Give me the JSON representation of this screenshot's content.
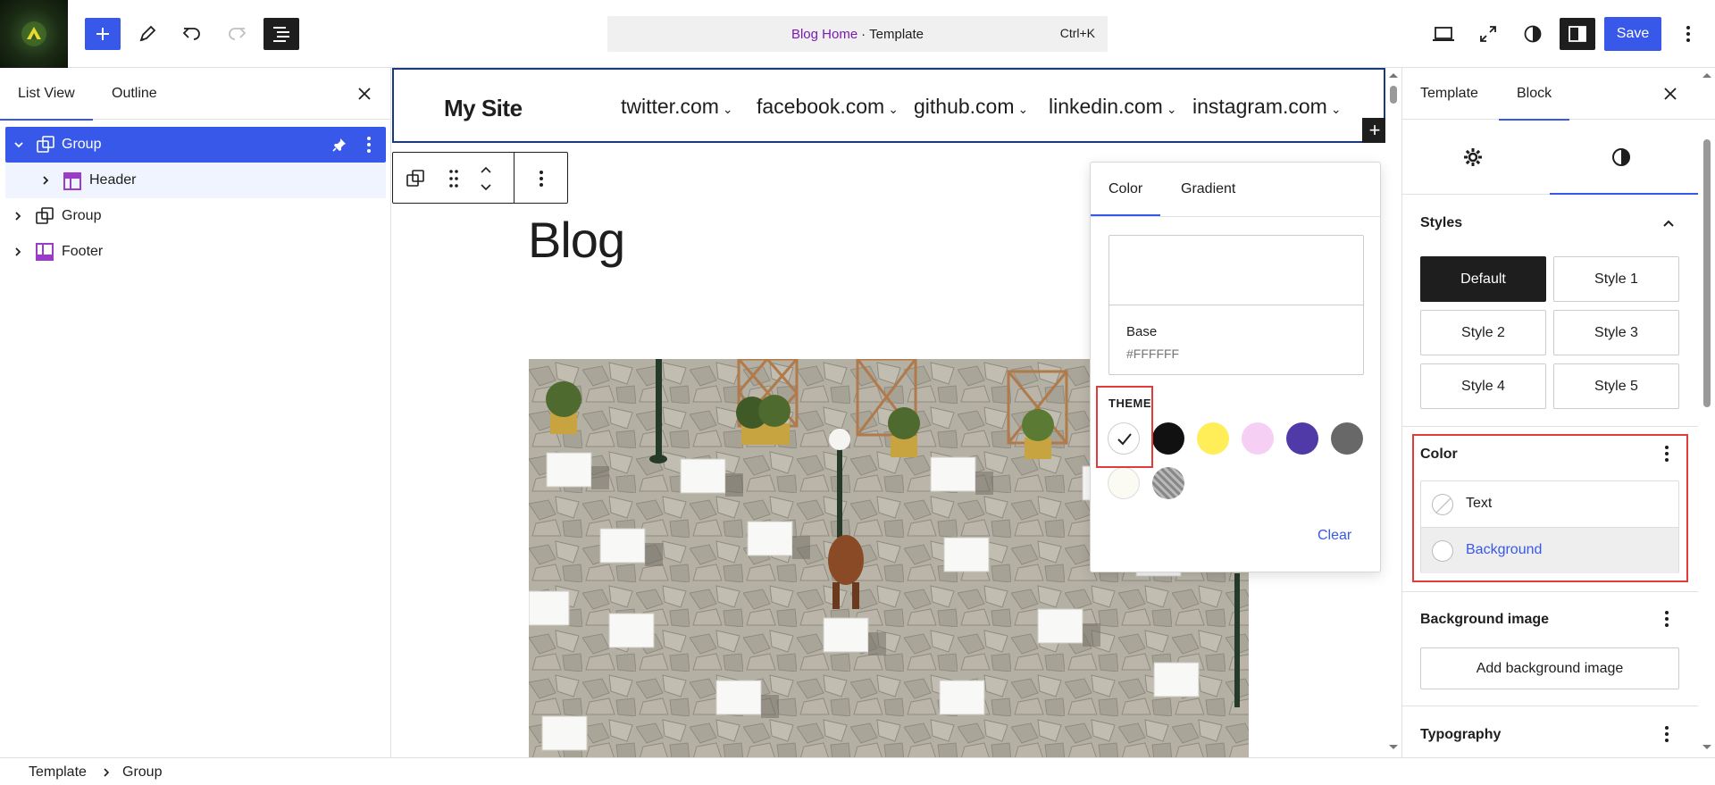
{
  "topbar": {
    "document_title": "Blog Home",
    "separator": "·",
    "document_kind": "Template",
    "shortcut": "Ctrl+K",
    "save_label": "Save"
  },
  "left_panel": {
    "tabs": [
      {
        "label": "List View"
      },
      {
        "label": "Outline"
      }
    ],
    "rows": [
      {
        "label": "Group",
        "icon": "group-icon",
        "selected": true
      },
      {
        "label": "Header",
        "icon": "template-part-icon"
      },
      {
        "label": "Group",
        "icon": "group-icon"
      },
      {
        "label": "Footer",
        "icon": "template-part-icon"
      }
    ]
  },
  "canvas": {
    "site_title": "My Site",
    "nav": [
      {
        "label": "twitter.com"
      },
      {
        "label": "facebook.com"
      },
      {
        "label": "github.com"
      },
      {
        "label": "linkedin.com"
      },
      {
        "label": "instagram.com"
      }
    ],
    "heading": "Blog"
  },
  "color_popover": {
    "tabs": [
      {
        "label": "Color"
      },
      {
        "label": "Gradient"
      }
    ],
    "selected_name": "Base",
    "selected_hex": "#FFFFFF",
    "theme_label": "THEME",
    "palette": [
      {
        "name": "base",
        "hex": "#FFFFFF",
        "selected": true
      },
      {
        "name": "contrast",
        "hex": "#111111"
      },
      {
        "name": "accent-1",
        "hex": "#FFEE58"
      },
      {
        "name": "accent-2",
        "hex": "#F6CFF4"
      },
      {
        "name": "accent-3",
        "hex": "#503AA8"
      },
      {
        "name": "accent-4",
        "hex": "#686868"
      },
      {
        "name": "accent-5",
        "hex": "#FBFAF3"
      },
      {
        "name": "transparent",
        "hex": "#9A9A9A"
      }
    ],
    "clear_label": "Clear"
  },
  "right_panel": {
    "tabs": [
      {
        "label": "Template"
      },
      {
        "label": "Block"
      }
    ],
    "styles_title": "Styles",
    "styles": [
      {
        "label": "Default",
        "active": true
      },
      {
        "label": "Style 1"
      },
      {
        "label": "Style 2"
      },
      {
        "label": "Style 3"
      },
      {
        "label": "Style 4"
      },
      {
        "label": "Style 5"
      }
    ],
    "color_title": "Color",
    "color_items": [
      {
        "label": "Text"
      },
      {
        "label": "Background"
      }
    ],
    "bgimage_title": "Background image",
    "bgimage_button": "Add background image",
    "typography_title": "Typography"
  },
  "breadcrumb": {
    "items": [
      "Template",
      "Group"
    ]
  },
  "colors": {
    "accent": "#3858e9",
    "highlight": "#e23b3b",
    "title_purple": "#7a1ab0"
  }
}
